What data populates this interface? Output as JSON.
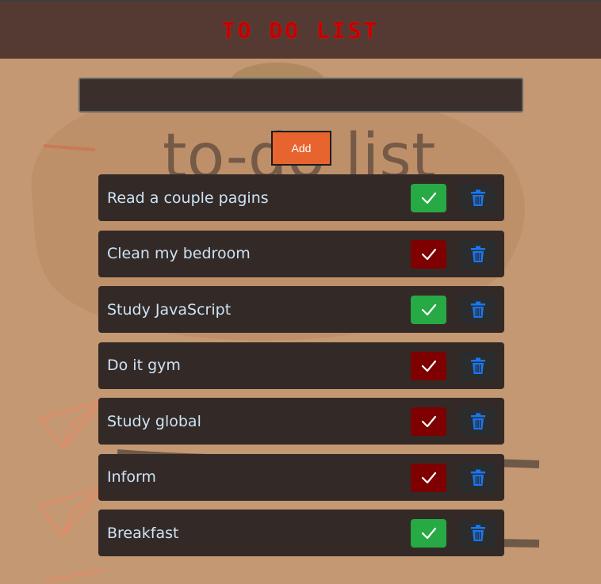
{
  "header": {
    "title": "TO DO LIST"
  },
  "background": {
    "watermark_text": "to-do list"
  },
  "input": {
    "value": "",
    "placeholder": ""
  },
  "add_button": {
    "label": "Add"
  },
  "colors": {
    "done": "#27a944",
    "pending": "#7e0000",
    "trash_icon": "#1877f2",
    "title": "#c40000"
  },
  "tasks": [
    {
      "text": "Read a couple pagins",
      "status": "done"
    },
    {
      "text": "Clean my bedroom",
      "status": "pending"
    },
    {
      "text": "Study JavaScript",
      "status": "done"
    },
    {
      "text": "Do it gym",
      "status": "pending"
    },
    {
      "text": "Study global",
      "status": "pending"
    },
    {
      "text": "Inform",
      "status": "pending"
    },
    {
      "text": "Breakfast",
      "status": "done"
    }
  ]
}
